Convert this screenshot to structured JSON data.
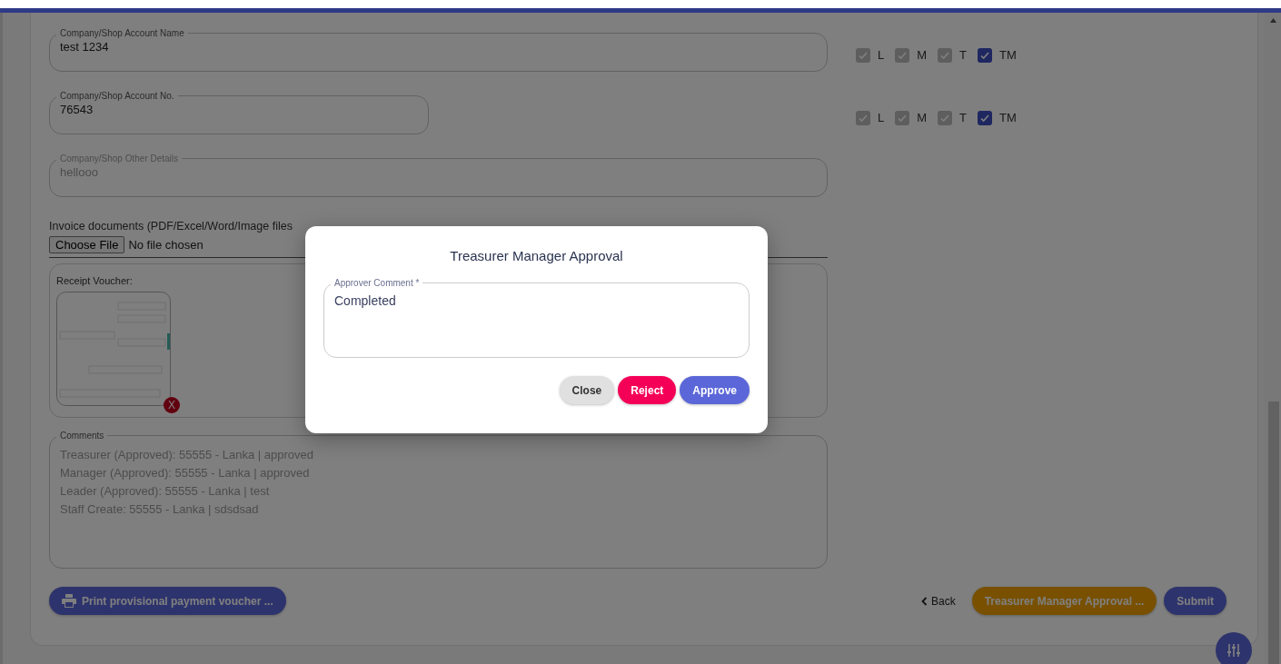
{
  "form": {
    "fields": [
      {
        "label": "Company/Shop Account Name",
        "value": "test 1234",
        "disabled": false,
        "wide": true,
        "checks": [
          {
            "label": "L",
            "checked": true,
            "disabled": true
          },
          {
            "label": "M",
            "checked": true,
            "disabled": true
          },
          {
            "label": "T",
            "checked": true,
            "disabled": true
          },
          {
            "label": "TM",
            "checked": true,
            "disabled": false
          }
        ]
      },
      {
        "label": "Company/Shop Account No.",
        "value": "76543",
        "disabled": false,
        "wide": false,
        "checks": [
          {
            "label": "L",
            "checked": true,
            "disabled": true
          },
          {
            "label": "M",
            "checked": true,
            "disabled": true
          },
          {
            "label": "T",
            "checked": true,
            "disabled": true
          },
          {
            "label": "TM",
            "checked": true,
            "disabled": false
          }
        ]
      },
      {
        "label": "Company/Shop Other Details",
        "value": "hellooo",
        "disabled": true,
        "wide": true
      }
    ],
    "upload": {
      "label": "Invoice documents (PDF/Excel/Word/Image files",
      "button": "Choose File",
      "status": "No file chosen"
    },
    "receipt": {
      "label": "Receipt Voucher:",
      "remove": "X"
    },
    "comments": {
      "label": "Comments",
      "lines": [
        "Treasurer (Approved): 55555 - Lanka | approved",
        "Manager (Approved): 55555 - Lanka | approved",
        "Leader (Approved): 55555 - Lanka | test",
        "Staff Create: 55555 - Lanka | sdsdsad"
      ]
    },
    "print_button": "Print provisional payment voucher ...",
    "back": "Back",
    "actions": [
      {
        "label": "Treasurer Manager Approval ...",
        "kind": "warning"
      },
      {
        "label": "Submit",
        "kind": "primary"
      }
    ]
  },
  "dialog": {
    "title": "Treasurer Manager Approval",
    "field_label": "Approver Comment *",
    "value": "Completed",
    "buttons": [
      {
        "label": "Close",
        "kind": "neutral"
      },
      {
        "label": "Reject",
        "kind": "danger"
      },
      {
        "label": "Approve",
        "kind": "primary"
      }
    ]
  }
}
